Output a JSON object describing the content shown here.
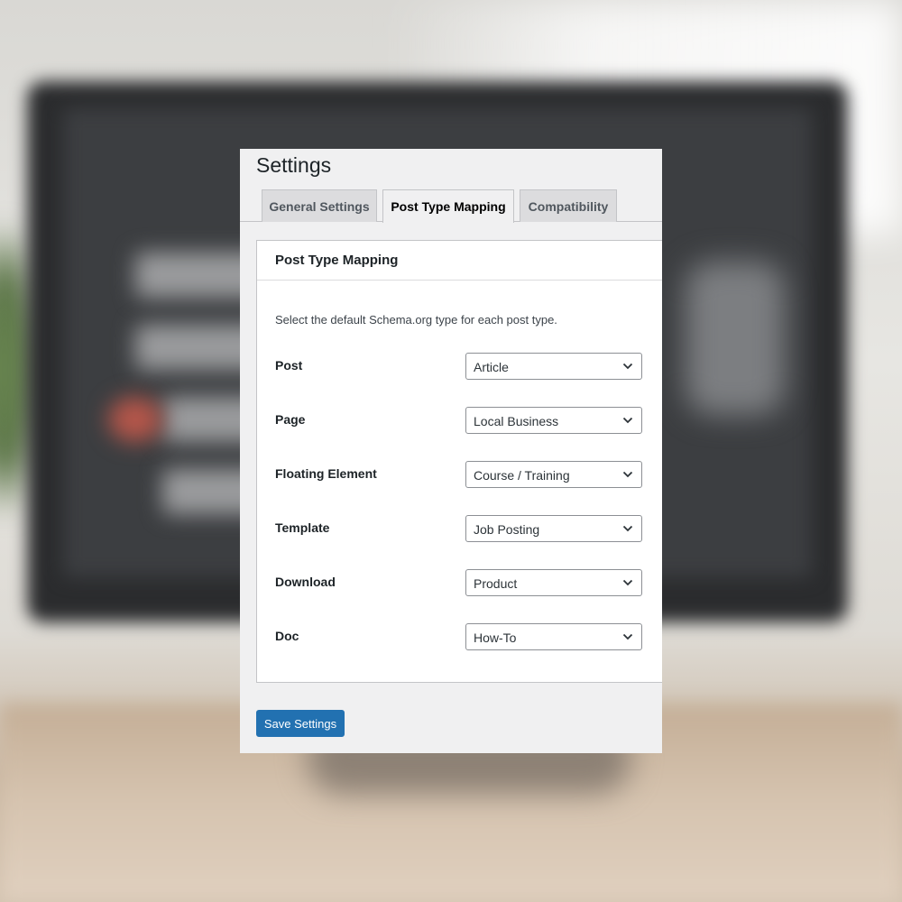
{
  "page": {
    "title": "Settings"
  },
  "tabs": [
    {
      "label": "General Settings",
      "active": false
    },
    {
      "label": "Post Type Mapping",
      "active": true
    },
    {
      "label": "Compatibility",
      "active": false
    }
  ],
  "card": {
    "title": "Post Type Mapping",
    "description": "Select the default Schema.org type for each post type."
  },
  "mappings": [
    {
      "label": "Post",
      "value": "Article"
    },
    {
      "label": "Page",
      "value": "Local Business"
    },
    {
      "label": "Floating Element",
      "value": "Course / Training"
    },
    {
      "label": "Template",
      "value": "Job Posting"
    },
    {
      "label": "Download",
      "value": "Product"
    },
    {
      "label": "Doc",
      "value": "How-To"
    }
  ],
  "actions": {
    "save_label": "Save Settings"
  },
  "icons": {
    "select_arrow": "chevron-down-icon"
  },
  "colors": {
    "primary": "#2271b1",
    "panel_bg": "#f0f0f1",
    "card_bg": "#ffffff"
  }
}
